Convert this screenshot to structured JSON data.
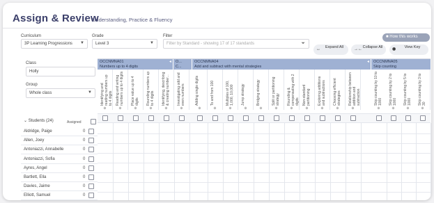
{
  "header": {
    "title": "Assign & Review",
    "subtitle": "Understanding, Practice & Fluency"
  },
  "controls": {
    "curriculum_label": "Curriculum",
    "curriculum_value": "3P Learning Progressions",
    "grade_label": "Grade",
    "grade_value": "Level 3",
    "filter_label": "Filter",
    "filter_placeholder": "Filter by Standard - showing 17 of 17 standards",
    "how_label": "How this works",
    "expand_label": "Expand All",
    "collapse_label": "Collapse All",
    "view_label": "View Key"
  },
  "left": {
    "class_label": "Class",
    "class_value": "Holly",
    "group_label": "Group",
    "group_value": "Whole class"
  },
  "strands": [
    {
      "code": "OCCNMNA01",
      "name": "Numbers up to 4 digits"
    },
    {
      "code": "O...",
      "name": "C..."
    },
    {
      "code": "OCCNMNA04",
      "name": "Add and subtract with mental strategies"
    },
    {
      "code": "OCCNMNA05",
      "name": "Skip counting"
    }
  ],
  "columns": [
    "Identifying and reading numbers up to 4 digits",
    "Reading and writing numbers up to 4 digits",
    "Place value up to 4 digits",
    "Rounding numbers up to 4 digits",
    "Identifying, describing & creating number...",
    "Investigating odd and even numbers",
    "Adding single digits",
    "To and from 100",
    "Multiples of 100, 1,000, 10,000",
    "Jump strategy",
    "Bridging strategy",
    "Split or partitioning strategy",
    "Rounding & compensating with 2 digits",
    "Non-standard partitioning",
    "Exploring additions and subtractions",
    "Choosing efficient strategies",
    "Relationship between addition and subtraction",
    "Skip counting by 10 to 1000",
    "Skip counting by 2 to 1000",
    "Skip counting by 5 to 1000",
    "Skip counting by 3 to 30"
  ],
  "students_header": "Students (24)",
  "assigned_label": "Assigned",
  "students": [
    {
      "name": "Aldridge, Paige",
      "assigned": "0"
    },
    {
      "name": "Allen, Joey",
      "assigned": "0"
    },
    {
      "name": "Antoniazzi, Annabelle",
      "assigned": "0"
    },
    {
      "name": "Antoniazzi, Sofia",
      "assigned": "0"
    },
    {
      "name": "Ayres, Angel",
      "assigned": "0"
    },
    {
      "name": "Bartlett, Ella",
      "assigned": "0"
    },
    {
      "name": "Davies, Jaime",
      "assigned": "0"
    },
    {
      "name": "Elliott, Samuel",
      "assigned": "0"
    }
  ],
  "colors": {
    "accent": "#3b3f6a",
    "strand": "#9fb1d3"
  }
}
